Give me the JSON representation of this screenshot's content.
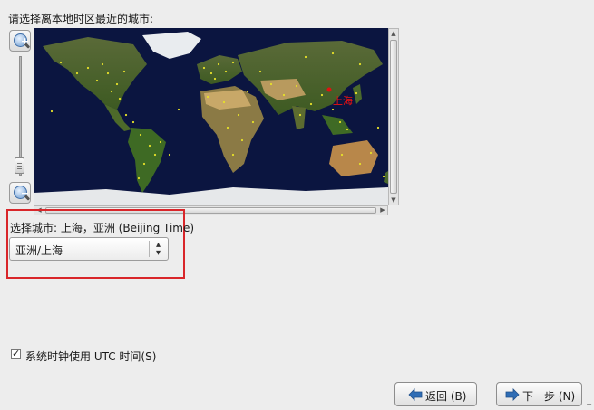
{
  "prompt": "请选择离本地时区最近的城市:",
  "map": {
    "selected_city_label": "上海"
  },
  "selection": {
    "label": "选择城市: 上海，亚洲 (Beijing Time)",
    "combo_value": "亚洲/上海"
  },
  "utc": {
    "label": "系统时钟使用 UTC 时间(S)",
    "checked": true
  },
  "buttons": {
    "back": "返回 (B)",
    "next": "下一步 (N)"
  },
  "colors": {
    "highlight": "#d9262a",
    "city_dot": "#e6e02a",
    "ocean": "#0b1540",
    "selected_city": "#e11111"
  },
  "icons": {
    "zoom_in": "zoom-in-icon",
    "zoom_out": "zoom-out-icon",
    "back": "left-arrow-icon",
    "next": "right-arrow-icon",
    "combo": "chevron-updown-icon"
  }
}
